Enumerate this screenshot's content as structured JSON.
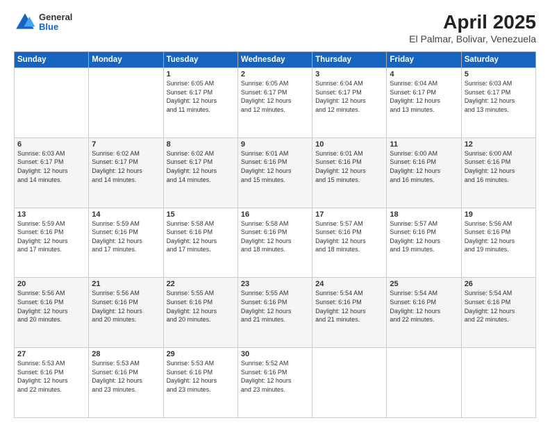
{
  "header": {
    "logo": {
      "general": "General",
      "blue": "Blue"
    },
    "title": "April 2025",
    "subtitle": "El Palmar, Bolivar, Venezuela"
  },
  "weekdays": [
    "Sunday",
    "Monday",
    "Tuesday",
    "Wednesday",
    "Thursday",
    "Friday",
    "Saturday"
  ],
  "weeks": [
    [
      {
        "day": "",
        "info": ""
      },
      {
        "day": "",
        "info": ""
      },
      {
        "day": "1",
        "info": "Sunrise: 6:05 AM\nSunset: 6:17 PM\nDaylight: 12 hours\nand 11 minutes."
      },
      {
        "day": "2",
        "info": "Sunrise: 6:05 AM\nSunset: 6:17 PM\nDaylight: 12 hours\nand 12 minutes."
      },
      {
        "day": "3",
        "info": "Sunrise: 6:04 AM\nSunset: 6:17 PM\nDaylight: 12 hours\nand 12 minutes."
      },
      {
        "day": "4",
        "info": "Sunrise: 6:04 AM\nSunset: 6:17 PM\nDaylight: 12 hours\nand 13 minutes."
      },
      {
        "day": "5",
        "info": "Sunrise: 6:03 AM\nSunset: 6:17 PM\nDaylight: 12 hours\nand 13 minutes."
      }
    ],
    [
      {
        "day": "6",
        "info": "Sunrise: 6:03 AM\nSunset: 6:17 PM\nDaylight: 12 hours\nand 14 minutes."
      },
      {
        "day": "7",
        "info": "Sunrise: 6:02 AM\nSunset: 6:17 PM\nDaylight: 12 hours\nand 14 minutes."
      },
      {
        "day": "8",
        "info": "Sunrise: 6:02 AM\nSunset: 6:17 PM\nDaylight: 12 hours\nand 14 minutes."
      },
      {
        "day": "9",
        "info": "Sunrise: 6:01 AM\nSunset: 6:16 PM\nDaylight: 12 hours\nand 15 minutes."
      },
      {
        "day": "10",
        "info": "Sunrise: 6:01 AM\nSunset: 6:16 PM\nDaylight: 12 hours\nand 15 minutes."
      },
      {
        "day": "11",
        "info": "Sunrise: 6:00 AM\nSunset: 6:16 PM\nDaylight: 12 hours\nand 16 minutes."
      },
      {
        "day": "12",
        "info": "Sunrise: 6:00 AM\nSunset: 6:16 PM\nDaylight: 12 hours\nand 16 minutes."
      }
    ],
    [
      {
        "day": "13",
        "info": "Sunrise: 5:59 AM\nSunset: 6:16 PM\nDaylight: 12 hours\nand 17 minutes."
      },
      {
        "day": "14",
        "info": "Sunrise: 5:59 AM\nSunset: 6:16 PM\nDaylight: 12 hours\nand 17 minutes."
      },
      {
        "day": "15",
        "info": "Sunrise: 5:58 AM\nSunset: 6:16 PM\nDaylight: 12 hours\nand 17 minutes."
      },
      {
        "day": "16",
        "info": "Sunrise: 5:58 AM\nSunset: 6:16 PM\nDaylight: 12 hours\nand 18 minutes."
      },
      {
        "day": "17",
        "info": "Sunrise: 5:57 AM\nSunset: 6:16 PM\nDaylight: 12 hours\nand 18 minutes."
      },
      {
        "day": "18",
        "info": "Sunrise: 5:57 AM\nSunset: 6:16 PM\nDaylight: 12 hours\nand 19 minutes."
      },
      {
        "day": "19",
        "info": "Sunrise: 5:56 AM\nSunset: 6:16 PM\nDaylight: 12 hours\nand 19 minutes."
      }
    ],
    [
      {
        "day": "20",
        "info": "Sunrise: 5:56 AM\nSunset: 6:16 PM\nDaylight: 12 hours\nand 20 minutes."
      },
      {
        "day": "21",
        "info": "Sunrise: 5:56 AM\nSunset: 6:16 PM\nDaylight: 12 hours\nand 20 minutes."
      },
      {
        "day": "22",
        "info": "Sunrise: 5:55 AM\nSunset: 6:16 PM\nDaylight: 12 hours\nand 20 minutes."
      },
      {
        "day": "23",
        "info": "Sunrise: 5:55 AM\nSunset: 6:16 PM\nDaylight: 12 hours\nand 21 minutes."
      },
      {
        "day": "24",
        "info": "Sunrise: 5:54 AM\nSunset: 6:16 PM\nDaylight: 12 hours\nand 21 minutes."
      },
      {
        "day": "25",
        "info": "Sunrise: 5:54 AM\nSunset: 6:16 PM\nDaylight: 12 hours\nand 22 minutes."
      },
      {
        "day": "26",
        "info": "Sunrise: 5:54 AM\nSunset: 6:16 PM\nDaylight: 12 hours\nand 22 minutes."
      }
    ],
    [
      {
        "day": "27",
        "info": "Sunrise: 5:53 AM\nSunset: 6:16 PM\nDaylight: 12 hours\nand 22 minutes."
      },
      {
        "day": "28",
        "info": "Sunrise: 5:53 AM\nSunset: 6:16 PM\nDaylight: 12 hours\nand 23 minutes."
      },
      {
        "day": "29",
        "info": "Sunrise: 5:53 AM\nSunset: 6:16 PM\nDaylight: 12 hours\nand 23 minutes."
      },
      {
        "day": "30",
        "info": "Sunrise: 5:52 AM\nSunset: 6:16 PM\nDaylight: 12 hours\nand 23 minutes."
      },
      {
        "day": "",
        "info": ""
      },
      {
        "day": "",
        "info": ""
      },
      {
        "day": "",
        "info": ""
      }
    ]
  ]
}
